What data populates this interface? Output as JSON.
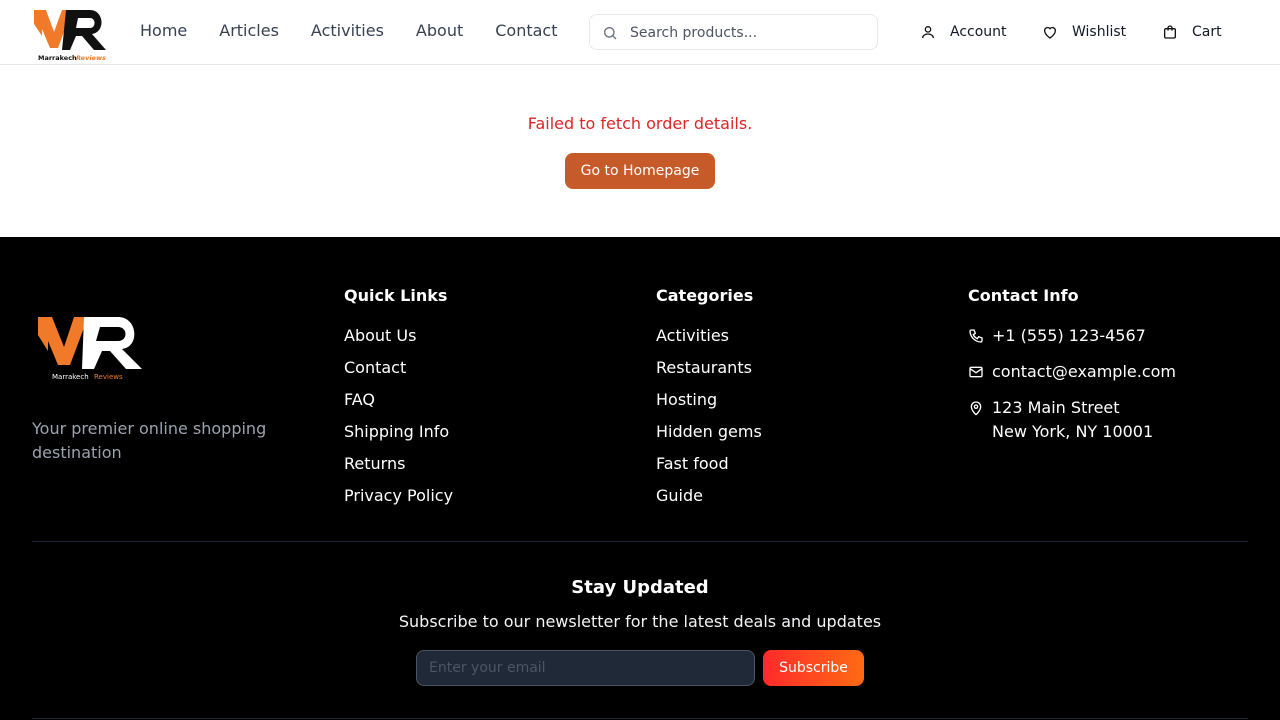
{
  "brand": {
    "logo_text": "Marrakech Reviews",
    "accent": "#f07a2a",
    "dark": "#111111"
  },
  "nav": {
    "items": [
      {
        "label": "Home"
      },
      {
        "label": "Articles"
      },
      {
        "label": "Activities"
      },
      {
        "label": "About"
      },
      {
        "label": "Contact"
      }
    ]
  },
  "search": {
    "placeholder": "Search products...",
    "icon": "search-icon"
  },
  "header_actions": {
    "account": {
      "label": "Account",
      "icon": "user-icon"
    },
    "wishlist": {
      "label": "Wishlist",
      "icon": "heart-icon"
    },
    "cart": {
      "label": "Cart",
      "icon": "shopping-bag-icon"
    }
  },
  "main": {
    "error": "Failed to fetch order details.",
    "error_color": "#dc2626",
    "home_button": "Go to Homepage",
    "button_color": "#c65a28"
  },
  "footer": {
    "tagline": "Your premier online shopping destination",
    "quick_links": {
      "title": "Quick Links",
      "items": [
        "About Us",
        "Contact",
        "FAQ",
        "Shipping Info",
        "Returns",
        "Privacy Policy"
      ]
    },
    "categories": {
      "title": "Categories",
      "items": [
        "Activities",
        "Restaurants",
        "Hosting",
        "Hidden gems",
        "Fast food",
        "Guide"
      ]
    },
    "contact": {
      "title": "Contact Info",
      "phone": "+1 (555) 123-4567",
      "email": "contact@example.com",
      "address_line1": "123 Main Street",
      "address_line2": "New York, NY 10001"
    },
    "newsletter": {
      "title": "Stay Updated",
      "text": "Subscribe to our newsletter for the latest deals and updates",
      "placeholder": "Enter your email",
      "button": "Subscribe"
    }
  }
}
